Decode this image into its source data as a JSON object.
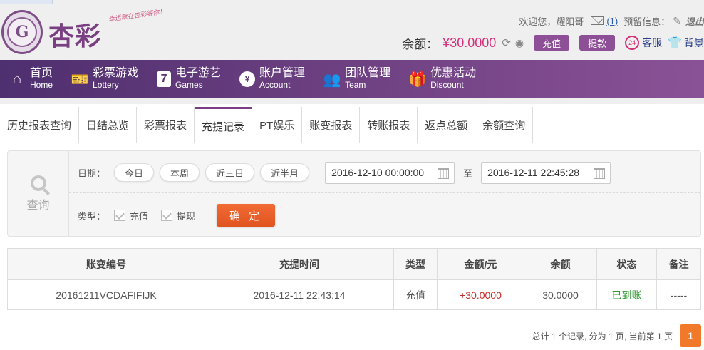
{
  "brand": {
    "name": "杏彩",
    "slogan": "幸运就在杏彩等你！"
  },
  "user_bar": {
    "welcome": "欢迎您，",
    "username": "耀阳哥",
    "messages_count": "(1)",
    "alert_label": "预留信息：",
    "logout": "退出"
  },
  "balance": {
    "label": "余额：",
    "value": "¥30.0000",
    "deposit_label": "充值",
    "withdraw_label": "提款",
    "service_label": "客服",
    "skin_label": "背景"
  },
  "nav": [
    {
      "cn": "首页",
      "en": "Home",
      "icon": "home-icon"
    },
    {
      "cn": "彩票游戏",
      "en": "Lottery",
      "icon": "lottery-ticket-icon"
    },
    {
      "cn": "电子游艺",
      "en": "Games",
      "icon": "slot-seven-icon"
    },
    {
      "cn": "账户管理",
      "en": "Account",
      "icon": "yen-coin-icon"
    },
    {
      "cn": "团队管理",
      "en": "Team",
      "icon": "team-icon"
    },
    {
      "cn": "优惠活动",
      "en": "Discount",
      "icon": "gift-icon"
    }
  ],
  "tabs": [
    {
      "label": "历史报表查询"
    },
    {
      "label": "日结总览"
    },
    {
      "label": "彩票报表"
    },
    {
      "label": "充提记录",
      "active": true
    },
    {
      "label": "PT娱乐"
    },
    {
      "label": "账变报表"
    },
    {
      "label": "转账报表"
    },
    {
      "label": "返点总额"
    },
    {
      "label": "余额查询"
    }
  ],
  "filter": {
    "query_label": "查询",
    "date_label": "日期：",
    "quick_ranges": [
      "今日",
      "本周",
      "近三日",
      "近半月"
    ],
    "date_from": "2016-12-10 00:00:00",
    "to_label": "至",
    "date_to": "2016-12-11 22:45:28",
    "type_label": "类型：",
    "type_options": [
      {
        "label": "充值",
        "checked": false
      },
      {
        "label": "提现",
        "checked": false
      }
    ],
    "confirm_label": "确 定"
  },
  "table": {
    "columns": [
      "账变编号",
      "充提时间",
      "类型",
      "金额/元",
      "余额",
      "状态",
      "备注"
    ],
    "rows": [
      [
        "20161211VCDAFIFIJK",
        "2016-12-11 22:43:14",
        "充值",
        "+30.0000",
        "30.0000",
        "已到账",
        "-----"
      ]
    ]
  },
  "pager": {
    "summary": "总计 1 个记录, 分为 1 页, 当前第 1 页",
    "current_page": "1"
  },
  "colors": {
    "brand_purple": "#7a3f82",
    "nav_gradient_start": "#4e2f6f",
    "nav_gradient_end": "#8a5296",
    "balance_pink": "#d5307a",
    "confirm_orange": "#e0541f",
    "amount_red": "#cc2a2a",
    "status_green": "#2f9a2f"
  }
}
